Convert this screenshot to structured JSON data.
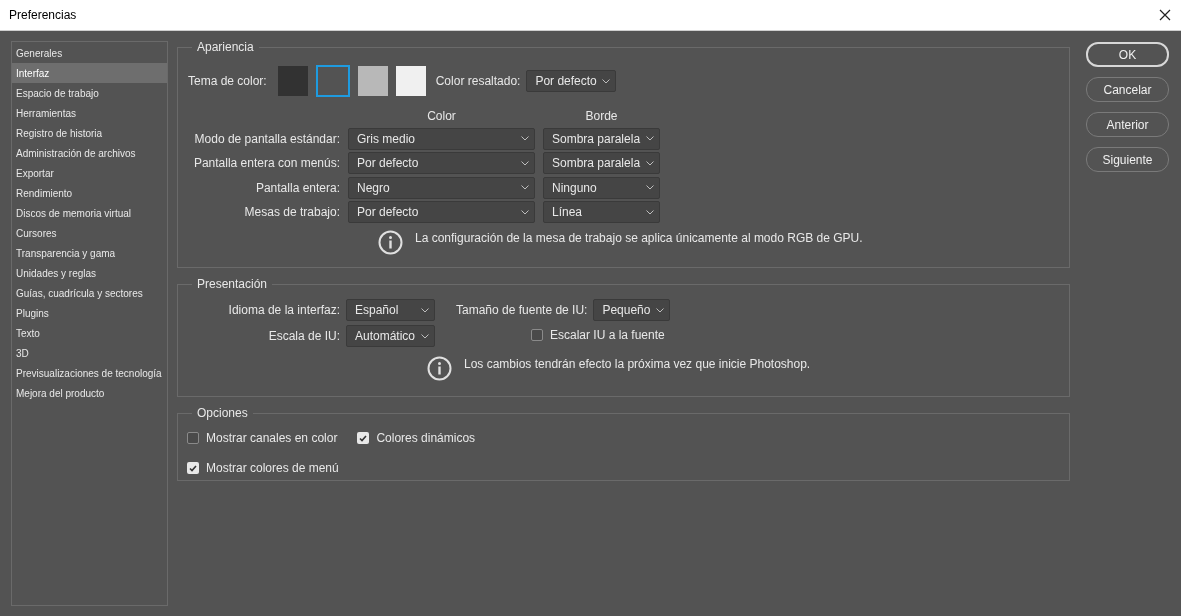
{
  "window": {
    "title": "Preferencias"
  },
  "sidebar": {
    "items": [
      {
        "label": "Generales",
        "selected": false
      },
      {
        "label": "Interfaz",
        "selected": true
      },
      {
        "label": "Espacio de trabajo",
        "selected": false
      },
      {
        "label": "Herramientas",
        "selected": false
      },
      {
        "label": "Registro de historia",
        "selected": false
      },
      {
        "label": "Administración de archivos",
        "selected": false
      },
      {
        "label": "Exportar",
        "selected": false
      },
      {
        "label": "Rendimiento",
        "selected": false
      },
      {
        "label": "Discos de memoria virtual",
        "selected": false
      },
      {
        "label": "Cursores",
        "selected": false
      },
      {
        "label": "Transparencia y gama",
        "selected": false
      },
      {
        "label": "Unidades y reglas",
        "selected": false
      },
      {
        "label": "Guías, cuadrícula y sectores",
        "selected": false
      },
      {
        "label": "Plugins",
        "selected": false
      },
      {
        "label": "Texto",
        "selected": false
      },
      {
        "label": "3D",
        "selected": false
      },
      {
        "label": "Previsualizaciones de tecnología",
        "selected": false
      },
      {
        "label": "Mejora del producto",
        "selected": false
      }
    ]
  },
  "appearance": {
    "title": "Apariencia",
    "color_theme": {
      "label": "Tema de color:",
      "swatches": [
        {
          "color": "#323232",
          "selected": false
        },
        {
          "color": "#535353",
          "selected": true
        },
        {
          "color": "#b8b8b8",
          "selected": false
        },
        {
          "color": "#f0f0f0",
          "selected": false
        }
      ]
    },
    "highlight": {
      "label": "Color resaltado:",
      "value": "Por defecto"
    },
    "columns": [
      "Color",
      "Borde"
    ],
    "rows": [
      {
        "label": "Modo de pantalla estándar:",
        "color_value": "Gris medio",
        "border": "Sombra paralela"
      },
      {
        "label": "Pantalla entera con menús:",
        "color_value": "Por defecto",
        "border": "Sombra paralela"
      },
      {
        "label": "Pantalla entera:",
        "color_value": "Negro",
        "border": "Ninguno"
      },
      {
        "label": "Mesas de trabajo:",
        "color_value": "Por defecto",
        "border": "Línea"
      }
    ],
    "info": "La configuración de la mesa de trabajo se aplica únicamente al modo RGB de GPU."
  },
  "presentation": {
    "title": "Presentación",
    "language": {
      "label": "Idioma de la interfaz:",
      "value": "Español"
    },
    "font_size": {
      "label": "Tamaño de fuente de IU:",
      "value": "Pequeño"
    },
    "ui_scale": {
      "label": "Escala de IU:",
      "value": "Automático"
    },
    "scale_to_font": {
      "label": "Escalar IU a la fuente",
      "checked": false
    },
    "info": "Los cambios tendrán efecto la próxima vez que inicie Photoshop."
  },
  "options": {
    "title": "Opciones",
    "rows": [
      [
        {
          "label": "Mostrar canales en color",
          "checked": false
        },
        {
          "label": "Colores dinámicos",
          "checked": true
        }
      ],
      [
        {
          "label": "Mostrar colores de menú",
          "checked": true
        }
      ]
    ]
  },
  "buttons": [
    {
      "label": "OK",
      "default": true
    },
    {
      "label": "Cancelar",
      "default": false
    },
    {
      "label": "Anterior",
      "default": false
    },
    {
      "label": "Siguiente",
      "default": false
    }
  ]
}
